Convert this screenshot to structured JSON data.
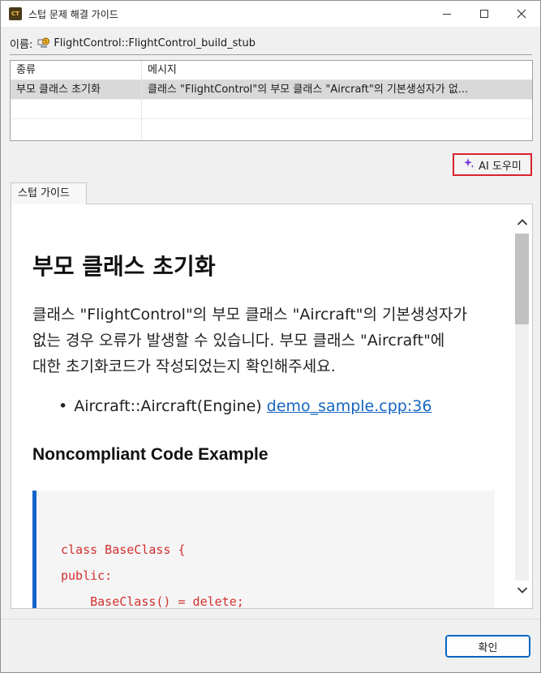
{
  "window": {
    "app_icon_text": "CT",
    "title": "스텁 문제 해결 가이드"
  },
  "name_row": {
    "label": "이름:",
    "value": "FlightControl::FlightControl_build_stub"
  },
  "table": {
    "headers": [
      "종류",
      "메시지"
    ],
    "rows": [
      {
        "kind": "부모 클래스 초기화",
        "message": "클래스 \"FlightControl\"의 부모 클래스 \"Aircraft\"의 기본생성자가 없..."
      }
    ]
  },
  "ai_button": {
    "label": "AI 도우미"
  },
  "tabs": [
    {
      "label": "스텁 가이드",
      "active": true
    }
  ],
  "guide": {
    "title": "부모 클래스 초기화",
    "description_lines": [
      "클래스 \"FlightControl\"의 부모 클래스 \"Aircraft\"의 기본생성자가",
      "없는 경우 오류가 발생할 수 있습니다. 부모 클래스 \"Aircraft\"에",
      "대한 초기화코드가 작성되었는지 확인해주세요."
    ],
    "bullet_text": "Aircraft::Aircraft(Engine)",
    "bullet_link": "demo_sample.cpp:36",
    "section_title": "Noncompliant Code Example",
    "code_lines": [
      "class BaseClass {",
      "public:",
      "    BaseClass() = delete;"
    ]
  },
  "footer": {
    "ok_label": "확인"
  },
  "colors": {
    "accent_blue": "#0067c0",
    "link_blue": "#1565c0",
    "code_red": "#d32f2f",
    "highlight_red": "#d9232e",
    "sparkle_purple": "#7b3fd6"
  }
}
